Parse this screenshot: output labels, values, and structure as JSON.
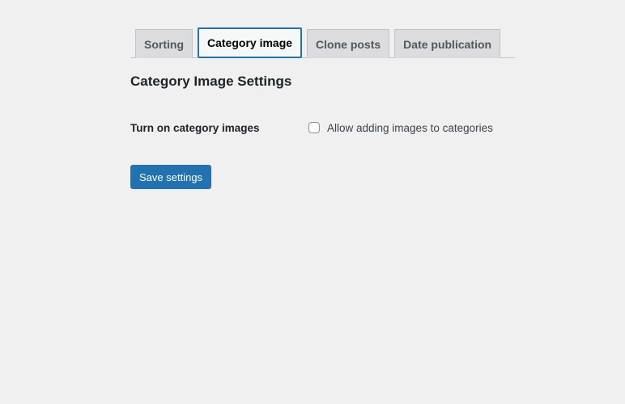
{
  "tabs": [
    {
      "label": "Sorting",
      "active": false
    },
    {
      "label": "Category image",
      "active": true
    },
    {
      "label": "Clone posts",
      "active": false
    },
    {
      "label": "Date publication",
      "active": false
    }
  ],
  "page": {
    "title": "Category Image Settings"
  },
  "settings": {
    "row_label": "Turn on category images",
    "checkbox_label": "Allow adding images to categories",
    "checkbox_checked": false
  },
  "actions": {
    "save_label": "Save settings"
  },
  "colors": {
    "accent": "#2271b1",
    "background": "#f0f0f1"
  }
}
